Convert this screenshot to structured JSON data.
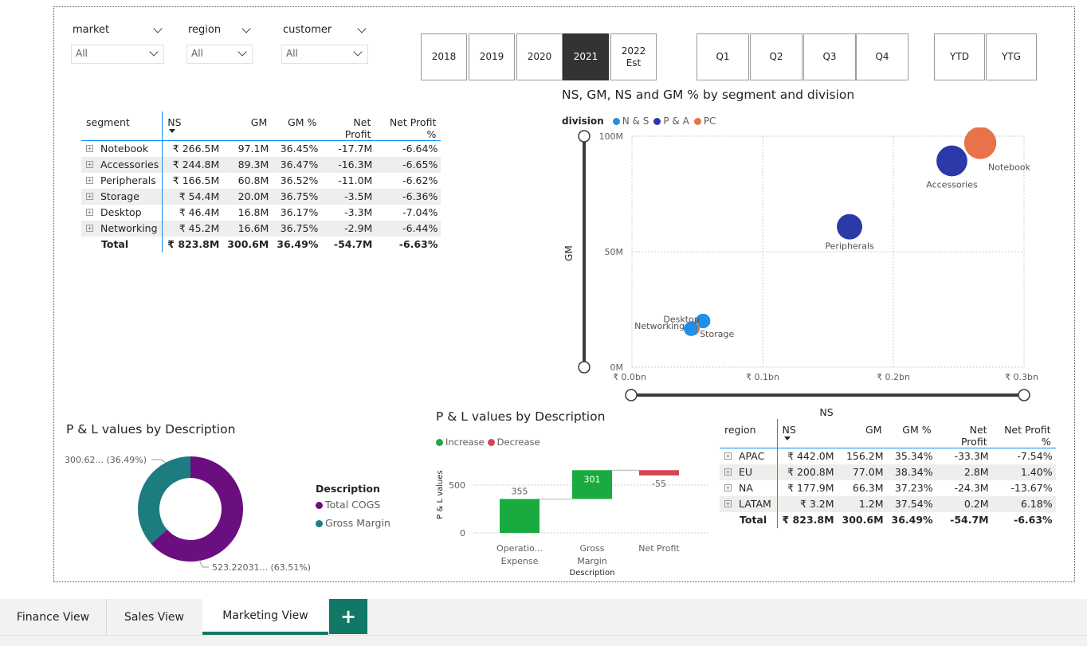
{
  "slicers": [
    {
      "title": "market",
      "value": "All"
    },
    {
      "title": "region",
      "value": "All"
    },
    {
      "title": "customer",
      "value": "All"
    }
  ],
  "year_tiles": [
    "2018",
    "2019",
    "2020",
    "2021",
    "2022\nEst"
  ],
  "selected_year": "2021",
  "quarter_tiles": [
    "Q1",
    "Q2",
    "Q3",
    "Q4"
  ],
  "ytd_tiles": [
    "YTD",
    "YTG"
  ],
  "segment_table": {
    "columns": [
      "segment",
      "NS",
      "GM",
      "GM %",
      "Net Profit",
      "Net Profit %"
    ],
    "rows": [
      [
        "Notebook",
        "₹ 266.5M",
        "97.1M",
        "36.45%",
        "-17.7M",
        "-6.64%"
      ],
      [
        "Accessories",
        "₹ 244.8M",
        "89.3M",
        "36.47%",
        "-16.3M",
        "-6.65%"
      ],
      [
        "Peripherals",
        "₹ 166.5M",
        "60.8M",
        "36.52%",
        "-11.0M",
        "-6.62%"
      ],
      [
        "Storage",
        "₹ 54.4M",
        "20.0M",
        "36.75%",
        "-3.5M",
        "-6.36%"
      ],
      [
        "Desktop",
        "₹ 46.4M",
        "16.8M",
        "36.17%",
        "-3.3M",
        "-7.04%"
      ],
      [
        "Networking",
        "₹ 45.2M",
        "16.6M",
        "36.75%",
        "-2.9M",
        "-6.44%"
      ]
    ],
    "total": [
      "Total",
      "₹ 823.8M",
      "300.6M",
      "36.49%",
      "-54.7M",
      "-6.63%"
    ]
  },
  "region_table": {
    "columns": [
      "region",
      "NS",
      "GM",
      "GM %",
      "Net Profit",
      "Net Profit %"
    ],
    "rows": [
      [
        "APAC",
        "₹ 442.0M",
        "156.2M",
        "35.34%",
        "-33.3M",
        "-7.54%"
      ],
      [
        "EU",
        "₹ 200.8M",
        "77.0M",
        "38.34%",
        "2.8M",
        "1.40%"
      ],
      [
        "NA",
        "₹ 177.9M",
        "66.3M",
        "37.23%",
        "-24.3M",
        "-13.67%"
      ],
      [
        "LATAM",
        "₹ 3.2M",
        "1.2M",
        "37.54%",
        "0.2M",
        "6.18%"
      ]
    ],
    "total": [
      "Total",
      "₹ 823.8M",
      "300.6M",
      "36.49%",
      "-54.7M",
      "-6.63%"
    ]
  },
  "scatter": {
    "title": "NS, GM, NS and GM % by segment and division",
    "legend_title": "division",
    "legend": [
      {
        "name": "N & S",
        "color": "#1f8fe8"
      },
      {
        "name": "P & A",
        "color": "#2b3aa8"
      },
      {
        "name": "PC",
        "color": "#e8734a"
      }
    ],
    "xlabel": "NS",
    "ylabel": "GM",
    "xticks": [
      "₹ 0.0bn",
      "₹ 0.1bn",
      "₹ 0.2bn",
      "₹ 0.3bn"
    ],
    "yticks": [
      "100M",
      "50M",
      "0M"
    ]
  },
  "donut": {
    "title": "P & L values by Description",
    "legend_title": "Description",
    "label_top": "300.62... (36.49%)",
    "label_bottom": "523.22031... (63.51%)",
    "legend": [
      {
        "name": "Total COGS",
        "color": "#6a0e80"
      },
      {
        "name": "Gross Margin",
        "color": "#1d7c7f"
      }
    ]
  },
  "waterfall": {
    "title": "P & L values by Description",
    "legend": [
      {
        "name": "Increase",
        "color": "#1aab40"
      },
      {
        "name": "Decrease",
        "color": "#d64550"
      }
    ],
    "ylabel": "P & L values",
    "xlabel": "Description",
    "yticks": [
      "500",
      "0"
    ],
    "cat_operatio_1": "Operatio...",
    "cat_operatio_2": "Expense",
    "cat_gross_1": "Gross",
    "cat_gross_2": "Margin",
    "cat_netprofit": "Net Profit"
  },
  "tabs": [
    "Finance View",
    "Sales View",
    "Marketing View"
  ],
  "active_tab": "Marketing View",
  "add_tab_label": "+",
  "chart_data": [
    {
      "type": "scatter",
      "title": "NS, GM, NS and GM % by segment and division",
      "xlabel": "NS",
      "ylabel": "GM",
      "xlim": [
        0,
        0.3
      ],
      "ylim": [
        0,
        100
      ],
      "x_unit": "₹ bn",
      "y_unit": "M",
      "grid": true,
      "legend_placement": "top-left",
      "series": [
        {
          "name": "PC",
          "points": [
            {
              "label": "Notebook",
              "x": 0.2665,
              "y": 97.1
            },
            {
              "label": "Desktop",
              "x": 0.0464,
              "y": 16.8
            }
          ]
        },
        {
          "name": "P & A",
          "points": [
            {
              "label": "Accessories",
              "x": 0.2448,
              "y": 89.3
            },
            {
              "label": "Peripherals",
              "x": 0.1665,
              "y": 60.8
            }
          ]
        },
        {
          "name": "N & S",
          "points": [
            {
              "label": "Storage",
              "x": 0.0544,
              "y": 20.0
            },
            {
              "label": "Networking",
              "x": 0.0452,
              "y": 16.6
            }
          ]
        }
      ]
    },
    {
      "type": "pie",
      "title": "P & L values by Description",
      "categories": [
        "Total COGS",
        "Gross Margin"
      ],
      "values": [
        523.22031,
        300.62
      ],
      "percentages": [
        63.51,
        36.49
      ]
    },
    {
      "type": "bar",
      "subtype": "waterfall",
      "title": "P & L values by Description",
      "xlabel": "Description",
      "ylabel": "P & L values",
      "categories": [
        "Operatio... Expense",
        "Gross Margin",
        "Net Profit"
      ],
      "values": [
        355,
        301,
        -55
      ],
      "ylim": [
        0,
        700
      ]
    }
  ]
}
